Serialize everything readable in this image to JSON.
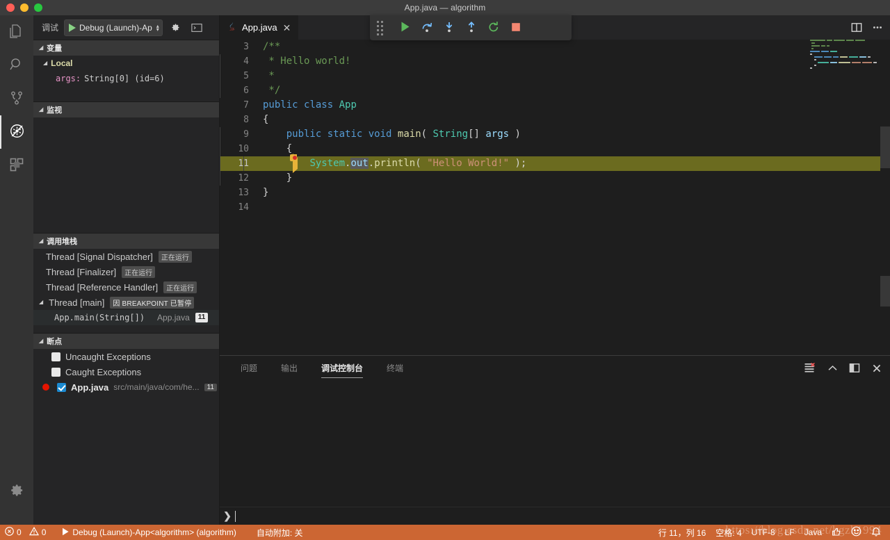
{
  "window": {
    "title": "App.java — algorithm",
    "traffic_lights": [
      "close",
      "minimize",
      "zoom"
    ]
  },
  "activity_bar": {
    "items": [
      {
        "icon": "files-explorer-icon",
        "label": "资源管理器",
        "active": false
      },
      {
        "icon": "search-icon",
        "label": "搜索",
        "active": false
      },
      {
        "icon": "source-control-icon",
        "label": "源代码管理",
        "active": false
      },
      {
        "icon": "run-and-debug-icon",
        "label": "运行和调试",
        "active": true
      },
      {
        "icon": "extensions-icon",
        "label": "扩展",
        "active": false
      }
    ],
    "bottom": [
      {
        "icon": "gear-icon",
        "label": "管理"
      }
    ]
  },
  "sidebar": {
    "toolbar": {
      "title": "调试",
      "start_icon": "play-icon",
      "launch_config": "Debug (Launch)-Ap",
      "gear_icon": "gear-icon",
      "console_icon": "open-debug-console-icon"
    },
    "variables": {
      "header": "变量",
      "scope": "Local",
      "rows": [
        {
          "name": "args:",
          "value": "String[0]  (id=6)"
        }
      ]
    },
    "watch": {
      "header": "监视",
      "rows": []
    },
    "call_stack": {
      "header": "调用堆栈",
      "threads": [
        {
          "name": "Thread [Signal Dispatcher]",
          "state": "正在运行",
          "expanded": false
        },
        {
          "name": "Thread [Finalizer]",
          "state": "正在运行",
          "expanded": false
        },
        {
          "name": "Thread [Reference Handler]",
          "state": "正在运行",
          "expanded": false
        },
        {
          "name": "Thread [main]",
          "state": "因 BREAKPOINT 已暂停",
          "expanded": true
        }
      ],
      "frame": {
        "name": "App.main(String[])",
        "file": "App.java",
        "line": "11"
      }
    },
    "breakpoints": {
      "header": "断点",
      "items": [
        {
          "label": "Uncaught Exceptions",
          "checked": false,
          "kind": "exception"
        },
        {
          "label": "Caught Exceptions",
          "checked": false,
          "kind": "exception"
        },
        {
          "label": "App.java",
          "path": "src/main/java/com/he...",
          "line": "11",
          "checked": true,
          "kind": "source"
        }
      ]
    }
  },
  "editor": {
    "tab": {
      "label": "App.java",
      "icon": "java-file-icon",
      "close_icon": "close-icon",
      "dirty": false
    },
    "tab_actions": [
      {
        "icon": "split-editor-icon"
      },
      {
        "icon": "more-actions-icon"
      }
    ],
    "debug_toolbar": {
      "grip_icon": "drag-handle-icon",
      "buttons": [
        {
          "icon": "continue-icon",
          "label": "继续"
        },
        {
          "icon": "step-over-icon",
          "label": "单步跳过"
        },
        {
          "icon": "step-into-icon",
          "label": "单步调试"
        },
        {
          "icon": "step-out-icon",
          "label": "单步跳出"
        },
        {
          "icon": "restart-icon",
          "label": "重启"
        },
        {
          "icon": "stop-icon",
          "label": "停止"
        }
      ]
    },
    "current_line": 11,
    "breakpoint_line": 11,
    "lines": [
      {
        "n": "3",
        "tokens": [
          {
            "t": "/**",
            "c": "k-cmt"
          }
        ],
        "indent_guides": 0
      },
      {
        "n": "4",
        "tokens": [
          {
            "t": " * Hello world!",
            "c": "k-cmt"
          }
        ],
        "indent_guides": 1
      },
      {
        "n": "5",
        "tokens": [
          {
            "t": " *",
            "c": "k-cmt"
          }
        ],
        "indent_guides": 1
      },
      {
        "n": "6",
        "tokens": [
          {
            "t": " */",
            "c": "k-cmt"
          }
        ],
        "indent_guides": 1
      },
      {
        "n": "7",
        "tokens": [
          {
            "t": "public ",
            "c": "k-kw"
          },
          {
            "t": "class ",
            "c": "k-kw"
          },
          {
            "t": "App",
            "c": "k-type"
          }
        ],
        "indent_guides": 0
      },
      {
        "n": "8",
        "tokens": [
          {
            "t": "{",
            "c": "k-plain"
          }
        ],
        "indent_guides": 0
      },
      {
        "n": "9",
        "tokens": [
          {
            "t": "    ",
            "c": "k-plain"
          },
          {
            "t": "public ",
            "c": "k-kw"
          },
          {
            "t": "static ",
            "c": "k-kw"
          },
          {
            "t": "void ",
            "c": "k-kw"
          },
          {
            "t": "main",
            "c": "k-fn"
          },
          {
            "t": "( ",
            "c": "k-plain"
          },
          {
            "t": "String",
            "c": "k-type"
          },
          {
            "t": "[] ",
            "c": "k-plain"
          },
          {
            "t": "args",
            "c": "k-var"
          },
          {
            "t": " )",
            "c": "k-plain"
          }
        ],
        "indent_guides": 1
      },
      {
        "n": "10",
        "tokens": [
          {
            "t": "    {",
            "c": "k-plain"
          }
        ],
        "indent_guides": 1
      },
      {
        "n": "11",
        "tokens": [
          {
            "t": "        ",
            "c": "k-plain"
          },
          {
            "t": "System",
            "c": "k-type"
          },
          {
            "t": ".",
            "c": "k-plain"
          },
          {
            "t": "out",
            "c": "k-var sel-out"
          },
          {
            "t": ".",
            "c": "k-plain"
          },
          {
            "t": "println",
            "c": "k-fn"
          },
          {
            "t": "( ",
            "c": "k-plain"
          },
          {
            "t": "\"Hello World!\"",
            "c": "k-str"
          },
          {
            "t": " );",
            "c": "k-plain"
          }
        ],
        "indent_guides": 2
      },
      {
        "n": "12",
        "tokens": [
          {
            "t": "    }",
            "c": "k-plain"
          }
        ],
        "indent_guides": 1
      },
      {
        "n": "13",
        "tokens": [
          {
            "t": "}",
            "c": "k-plain"
          }
        ],
        "indent_guides": 0
      },
      {
        "n": "14",
        "tokens": [
          {
            "t": "",
            "c": "k-plain"
          }
        ],
        "indent_guides": 0
      }
    ]
  },
  "panel": {
    "tabs": [
      {
        "label": "问题",
        "active": false
      },
      {
        "label": "输出",
        "active": false
      },
      {
        "label": "调试控制台",
        "active": true
      },
      {
        "label": "终端",
        "active": false
      }
    ],
    "actions": [
      {
        "icon": "clear-console-icon"
      },
      {
        "icon": "chevron-up-icon"
      },
      {
        "icon": "maximize-panel-icon"
      },
      {
        "icon": "close-icon"
      }
    ],
    "repl": {
      "prompt": "❯",
      "value": "",
      "placeholder": ""
    },
    "console_output": []
  },
  "status_bar": {
    "errors_icon": "error-icon",
    "errors": "0",
    "warnings_icon": "warning-icon",
    "warnings": "0",
    "debug_icon": "play-icon",
    "debug_session": "Debug (Launch)-App<algorithm> (algorithm)",
    "auto_attach": "自动附加: 关",
    "cursor": "行 11，列 16",
    "indent": "空格: 4",
    "encoding": "UTF-8",
    "eol": "LF",
    "language": "Java",
    "feedback_icon": "thumbs-up-icon",
    "smiley_icon": "smiley-icon",
    "bell_icon": "bell-icon"
  },
  "watermark": "https://blog.csdn.net/hgzh1994",
  "colors": {
    "status_bar_debug": "#cc6633",
    "accent_green": "#89d185",
    "accent_blue": "#75beff",
    "breakpoint_red": "#e51400",
    "current_line": "#6b6b1f",
    "stop_red": "#f48771"
  }
}
